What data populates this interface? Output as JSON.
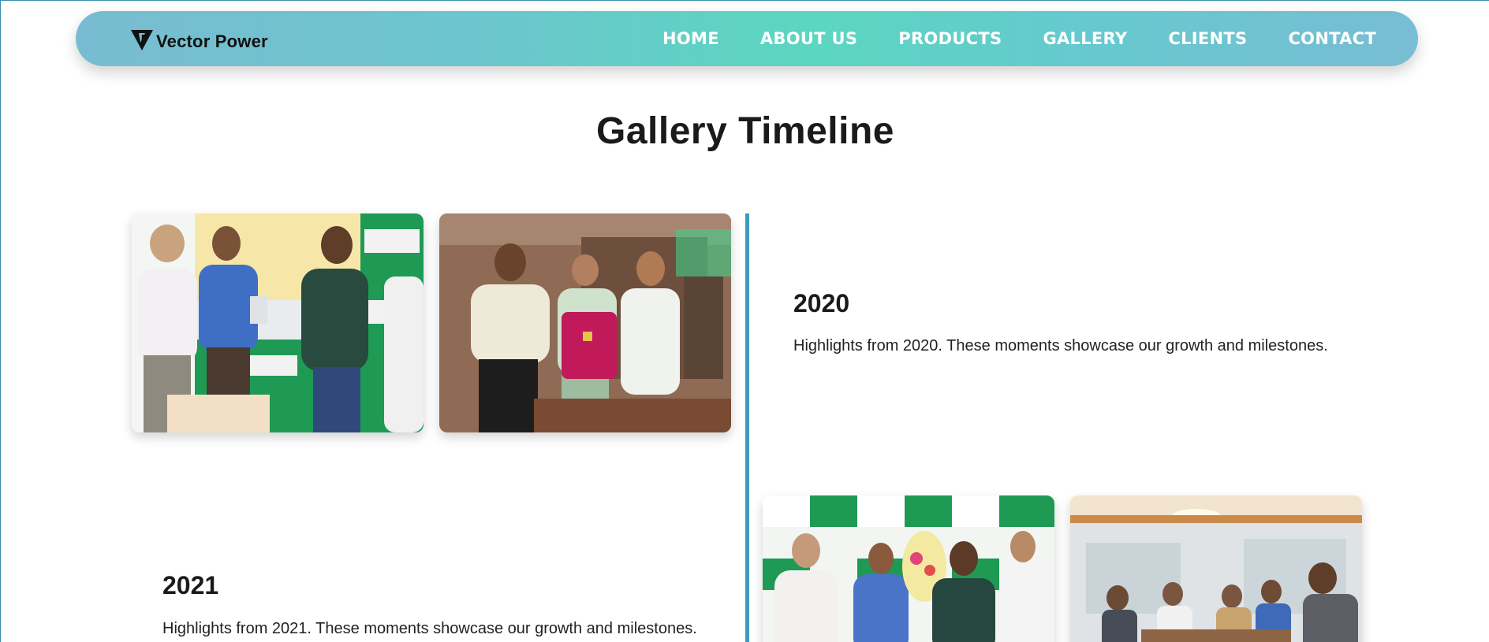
{
  "brand": {
    "name": "Vector Power",
    "logo_icon": "vector-v-logo-icon"
  },
  "nav": {
    "items": [
      {
        "label": "HOME"
      },
      {
        "label": "ABOUT US"
      },
      {
        "label": "PRODUCTS"
      },
      {
        "label": "GALLERY"
      },
      {
        "label": "CLIENTS"
      },
      {
        "label": "CONTACT"
      }
    ]
  },
  "page": {
    "title": "Gallery Timeline"
  },
  "timeline": [
    {
      "year": "2020",
      "description": "Highlights from 2020. These moments showcase our growth and milestones.",
      "photos": [
        "award-ceremony-photo",
        "jersey-presentation-photo"
      ]
    },
    {
      "year": "2021",
      "description": "Highlights from 2021. These moments showcase our growth and milestones.",
      "photos": [
        "bouquet-presentation-photo",
        "meeting-room-photo"
      ]
    }
  ],
  "colors": {
    "nav_gradient_start": "#78bcd1",
    "nav_gradient_mid": "#5bd6c0",
    "timeline_line": "#3d9bbc",
    "backdrop_green": "#1f9a55"
  }
}
